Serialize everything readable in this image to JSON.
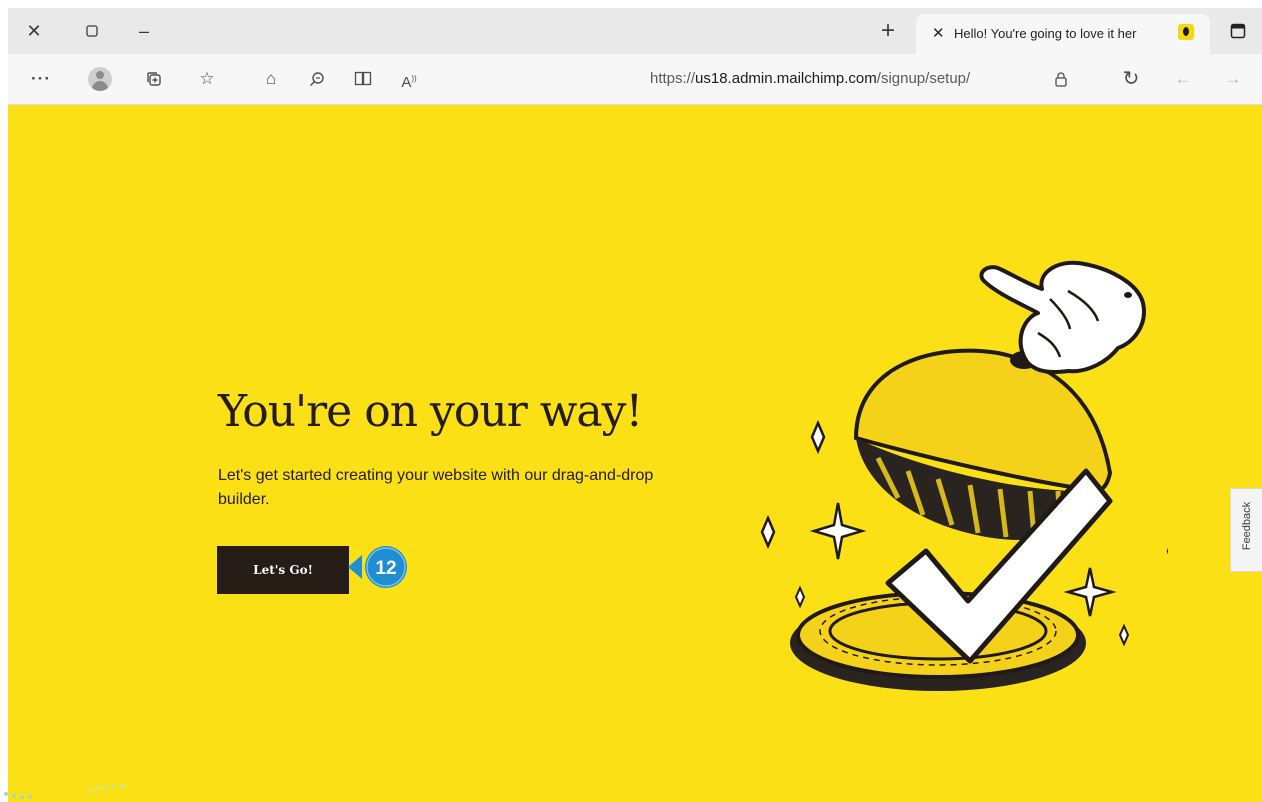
{
  "browser": {
    "tab": {
      "title": "Hello! You're going to love it her",
      "favicon": "mailchimp-icon"
    },
    "window_controls": [
      "close-icon",
      "maximize-icon",
      "minimize-icon"
    ],
    "new_tab_symbol": "+",
    "address": {
      "prefix": "https://",
      "domain": "us18.admin.mailchimp.com",
      "path": "/signup/setup/"
    },
    "toolbar_icons": [
      "more-icon",
      "profile-icon",
      "collections-icon",
      "favorites-icon",
      "add-favorite-icon",
      "find-icon",
      "immersive-reader-icon",
      "read-aloud-icon",
      "lock-icon",
      "refresh-icon",
      "back-icon",
      "forward-icon"
    ]
  },
  "page": {
    "headline": "You're on your way!",
    "subtext": "Let's get started creating your website with our drag-and-drop builder.",
    "cta_label": "Let's Go!",
    "feedback_label": "Feedback",
    "background_color": "#fbe016"
  },
  "callout": {
    "number": "12",
    "color": "#1f8fd1"
  }
}
